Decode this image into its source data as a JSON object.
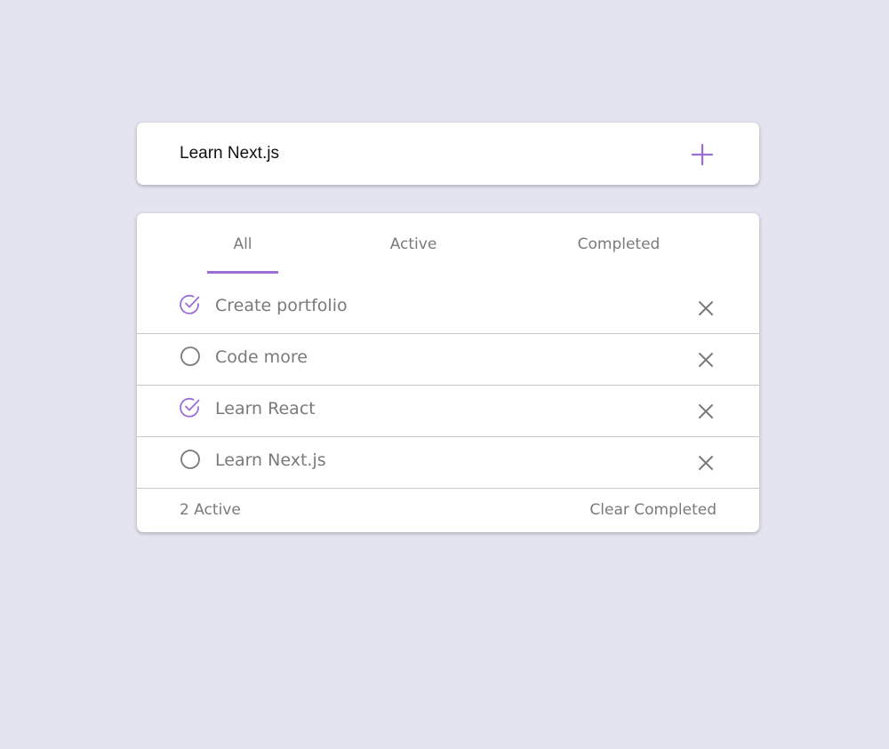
{
  "input": {
    "value": "Learn Next.js",
    "add_icon": "plus-icon"
  },
  "tabs": [
    {
      "label": "All",
      "selected": true
    },
    {
      "label": "Active",
      "selected": false
    },
    {
      "label": "Completed",
      "selected": false
    }
  ],
  "todos": [
    {
      "text": "Create portfolio",
      "completed": true
    },
    {
      "text": "Code more",
      "completed": false
    },
    {
      "text": "Learn React",
      "completed": true
    },
    {
      "text": "Learn Next.js",
      "completed": false
    }
  ],
  "footer": {
    "active_count": "2 Active",
    "clear_label": "Clear Completed"
  },
  "colors": {
    "accent": "#9b6fd6",
    "text_muted": "#7a7a7a",
    "background": "#e4e4f0"
  }
}
